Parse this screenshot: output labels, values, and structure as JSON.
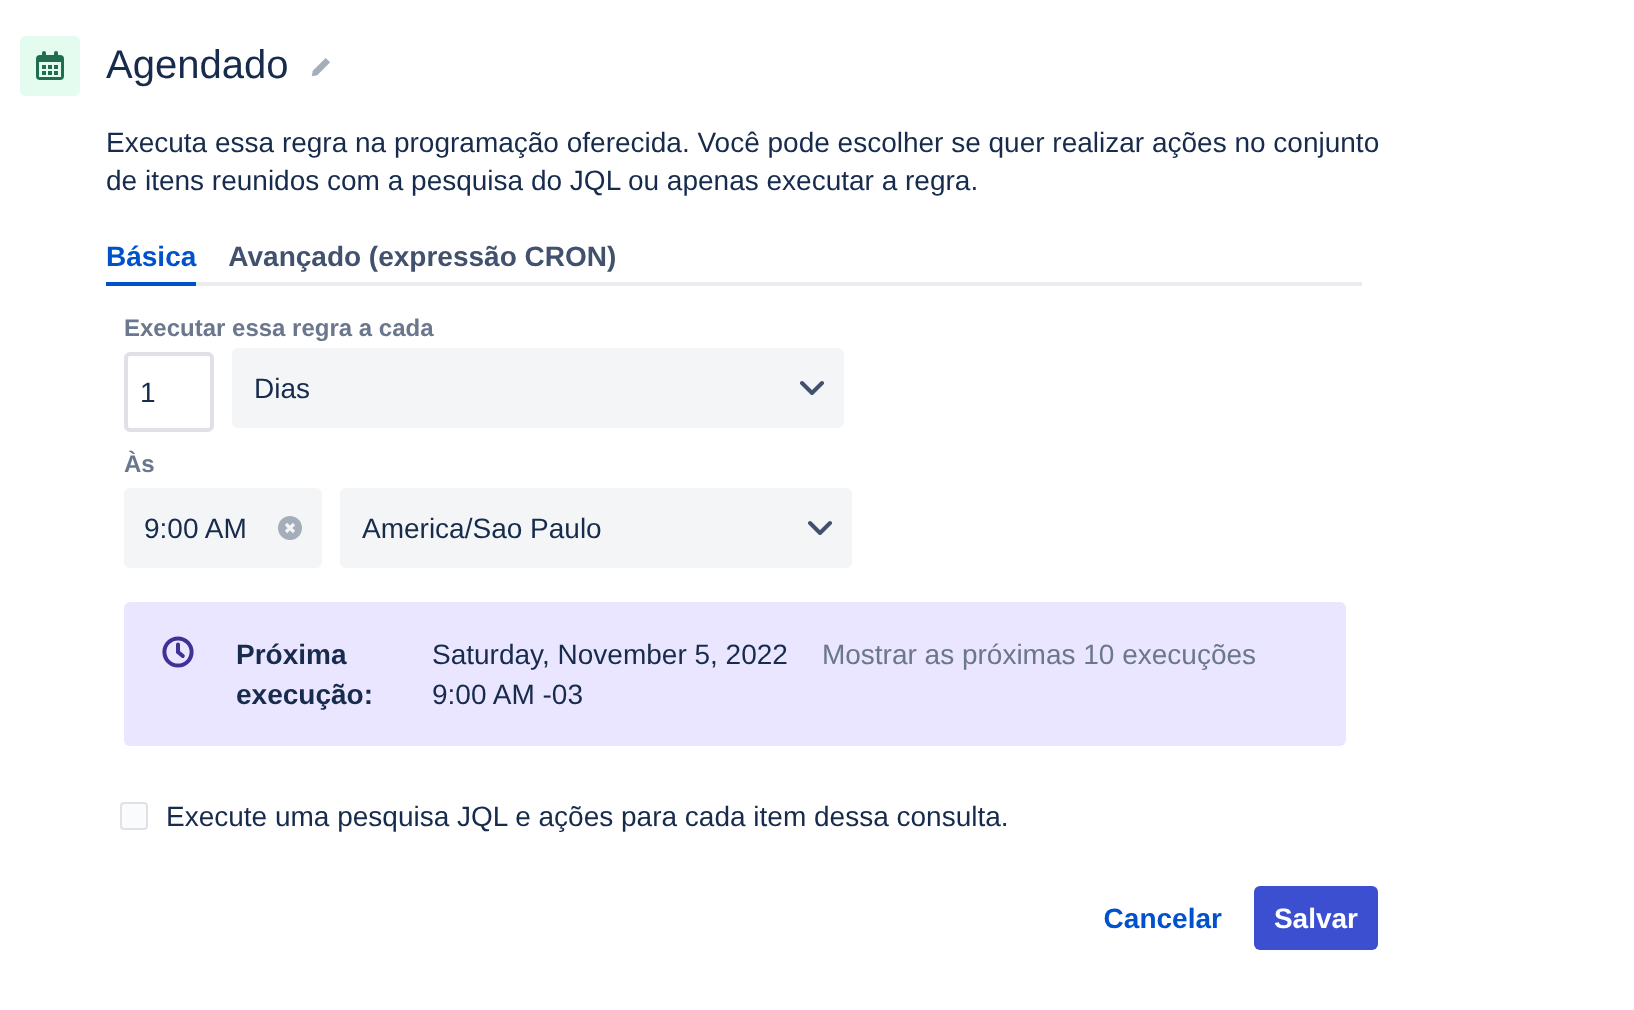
{
  "header": {
    "title": "Agendado"
  },
  "description": "Executa essa regra na programação oferecida. Você pode escolher se quer realizar ações no conjunto de itens reunidos com a pesquisa do JQL ou apenas executar a regra.",
  "tabs": [
    {
      "label": "Básica",
      "selected": true
    },
    {
      "label": "Avançado (expressão CRON)",
      "selected": false
    }
  ],
  "interval": {
    "label": "Executar essa regra a cada",
    "value": "1",
    "unit": "Dias"
  },
  "time": {
    "label": "Às",
    "value": "9:00 AM",
    "timezone": "America/Sao Paulo"
  },
  "next_run": {
    "label": "Próxima execução:",
    "date": "Saturday, November 5, 2022",
    "time": "9:00 AM -03",
    "link": "Mostrar as próximas 10 execuções"
  },
  "jql_option": {
    "label": "Execute uma pesquisa JQL e ações para cada item dessa consulta.",
    "checked": false
  },
  "buttons": [
    {
      "label": "Cancelar",
      "kind": "link"
    },
    {
      "label": "Salvar",
      "kind": "primary"
    }
  ]
}
